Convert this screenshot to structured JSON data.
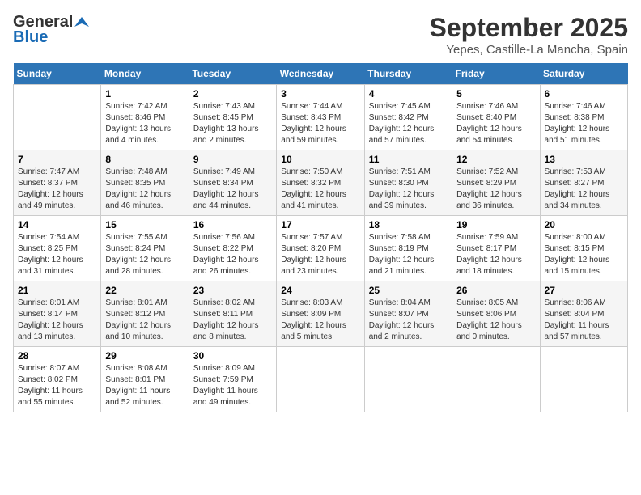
{
  "logo": {
    "general": "General",
    "blue": "Blue"
  },
  "title": "September 2025",
  "subtitle": "Yepes, Castille-La Mancha, Spain",
  "days_of_week": [
    "Sunday",
    "Monday",
    "Tuesday",
    "Wednesday",
    "Thursday",
    "Friday",
    "Saturday"
  ],
  "weeks": [
    [
      {
        "num": "",
        "sunrise": "",
        "sunset": "",
        "daylight": ""
      },
      {
        "num": "1",
        "sunrise": "Sunrise: 7:42 AM",
        "sunset": "Sunset: 8:46 PM",
        "daylight": "Daylight: 13 hours and 4 minutes."
      },
      {
        "num": "2",
        "sunrise": "Sunrise: 7:43 AM",
        "sunset": "Sunset: 8:45 PM",
        "daylight": "Daylight: 13 hours and 2 minutes."
      },
      {
        "num": "3",
        "sunrise": "Sunrise: 7:44 AM",
        "sunset": "Sunset: 8:43 PM",
        "daylight": "Daylight: 12 hours and 59 minutes."
      },
      {
        "num": "4",
        "sunrise": "Sunrise: 7:45 AM",
        "sunset": "Sunset: 8:42 PM",
        "daylight": "Daylight: 12 hours and 57 minutes."
      },
      {
        "num": "5",
        "sunrise": "Sunrise: 7:46 AM",
        "sunset": "Sunset: 8:40 PM",
        "daylight": "Daylight: 12 hours and 54 minutes."
      },
      {
        "num": "6",
        "sunrise": "Sunrise: 7:46 AM",
        "sunset": "Sunset: 8:38 PM",
        "daylight": "Daylight: 12 hours and 51 minutes."
      }
    ],
    [
      {
        "num": "7",
        "sunrise": "Sunrise: 7:47 AM",
        "sunset": "Sunset: 8:37 PM",
        "daylight": "Daylight: 12 hours and 49 minutes."
      },
      {
        "num": "8",
        "sunrise": "Sunrise: 7:48 AM",
        "sunset": "Sunset: 8:35 PM",
        "daylight": "Daylight: 12 hours and 46 minutes."
      },
      {
        "num": "9",
        "sunrise": "Sunrise: 7:49 AM",
        "sunset": "Sunset: 8:34 PM",
        "daylight": "Daylight: 12 hours and 44 minutes."
      },
      {
        "num": "10",
        "sunrise": "Sunrise: 7:50 AM",
        "sunset": "Sunset: 8:32 PM",
        "daylight": "Daylight: 12 hours and 41 minutes."
      },
      {
        "num": "11",
        "sunrise": "Sunrise: 7:51 AM",
        "sunset": "Sunset: 8:30 PM",
        "daylight": "Daylight: 12 hours and 39 minutes."
      },
      {
        "num": "12",
        "sunrise": "Sunrise: 7:52 AM",
        "sunset": "Sunset: 8:29 PM",
        "daylight": "Daylight: 12 hours and 36 minutes."
      },
      {
        "num": "13",
        "sunrise": "Sunrise: 7:53 AM",
        "sunset": "Sunset: 8:27 PM",
        "daylight": "Daylight: 12 hours and 34 minutes."
      }
    ],
    [
      {
        "num": "14",
        "sunrise": "Sunrise: 7:54 AM",
        "sunset": "Sunset: 8:25 PM",
        "daylight": "Daylight: 12 hours and 31 minutes."
      },
      {
        "num": "15",
        "sunrise": "Sunrise: 7:55 AM",
        "sunset": "Sunset: 8:24 PM",
        "daylight": "Daylight: 12 hours and 28 minutes."
      },
      {
        "num": "16",
        "sunrise": "Sunrise: 7:56 AM",
        "sunset": "Sunset: 8:22 PM",
        "daylight": "Daylight: 12 hours and 26 minutes."
      },
      {
        "num": "17",
        "sunrise": "Sunrise: 7:57 AM",
        "sunset": "Sunset: 8:20 PM",
        "daylight": "Daylight: 12 hours and 23 minutes."
      },
      {
        "num": "18",
        "sunrise": "Sunrise: 7:58 AM",
        "sunset": "Sunset: 8:19 PM",
        "daylight": "Daylight: 12 hours and 21 minutes."
      },
      {
        "num": "19",
        "sunrise": "Sunrise: 7:59 AM",
        "sunset": "Sunset: 8:17 PM",
        "daylight": "Daylight: 12 hours and 18 minutes."
      },
      {
        "num": "20",
        "sunrise": "Sunrise: 8:00 AM",
        "sunset": "Sunset: 8:15 PM",
        "daylight": "Daylight: 12 hours and 15 minutes."
      }
    ],
    [
      {
        "num": "21",
        "sunrise": "Sunrise: 8:01 AM",
        "sunset": "Sunset: 8:14 PM",
        "daylight": "Daylight: 12 hours and 13 minutes."
      },
      {
        "num": "22",
        "sunrise": "Sunrise: 8:01 AM",
        "sunset": "Sunset: 8:12 PM",
        "daylight": "Daylight: 12 hours and 10 minutes."
      },
      {
        "num": "23",
        "sunrise": "Sunrise: 8:02 AM",
        "sunset": "Sunset: 8:11 PM",
        "daylight": "Daylight: 12 hours and 8 minutes."
      },
      {
        "num": "24",
        "sunrise": "Sunrise: 8:03 AM",
        "sunset": "Sunset: 8:09 PM",
        "daylight": "Daylight: 12 hours and 5 minutes."
      },
      {
        "num": "25",
        "sunrise": "Sunrise: 8:04 AM",
        "sunset": "Sunset: 8:07 PM",
        "daylight": "Daylight: 12 hours and 2 minutes."
      },
      {
        "num": "26",
        "sunrise": "Sunrise: 8:05 AM",
        "sunset": "Sunset: 8:06 PM",
        "daylight": "Daylight: 12 hours and 0 minutes."
      },
      {
        "num": "27",
        "sunrise": "Sunrise: 8:06 AM",
        "sunset": "Sunset: 8:04 PM",
        "daylight": "Daylight: 11 hours and 57 minutes."
      }
    ],
    [
      {
        "num": "28",
        "sunrise": "Sunrise: 8:07 AM",
        "sunset": "Sunset: 8:02 PM",
        "daylight": "Daylight: 11 hours and 55 minutes."
      },
      {
        "num": "29",
        "sunrise": "Sunrise: 8:08 AM",
        "sunset": "Sunset: 8:01 PM",
        "daylight": "Daylight: 11 hours and 52 minutes."
      },
      {
        "num": "30",
        "sunrise": "Sunrise: 8:09 AM",
        "sunset": "Sunset: 7:59 PM",
        "daylight": "Daylight: 11 hours and 49 minutes."
      },
      {
        "num": "",
        "sunrise": "",
        "sunset": "",
        "daylight": ""
      },
      {
        "num": "",
        "sunrise": "",
        "sunset": "",
        "daylight": ""
      },
      {
        "num": "",
        "sunrise": "",
        "sunset": "",
        "daylight": ""
      },
      {
        "num": "",
        "sunrise": "",
        "sunset": "",
        "daylight": ""
      }
    ]
  ]
}
